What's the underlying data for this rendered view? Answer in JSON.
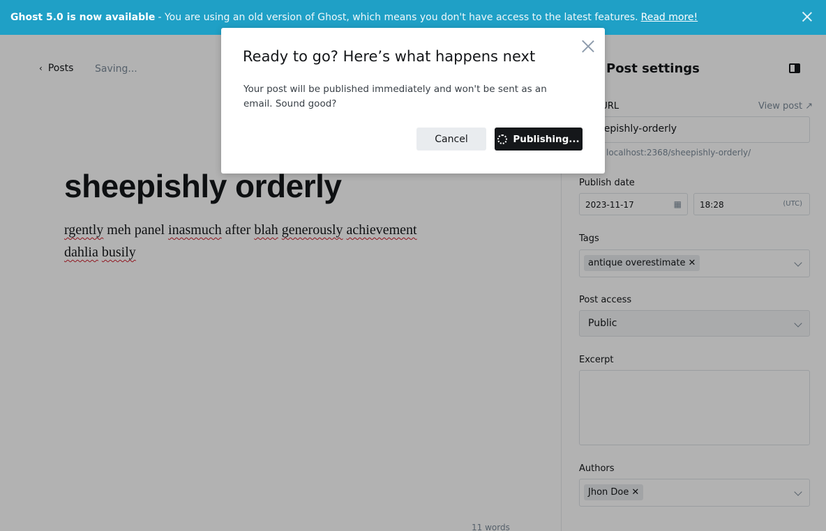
{
  "banner": {
    "headline": "Ghost 5.0 is now available",
    "message": "- You are using an old version of Ghost, which means you don't have access to the latest features.",
    "link": "Read more!"
  },
  "editor": {
    "back_label": "Posts",
    "status": "Saving...",
    "title": "sheepishly orderly",
    "body_words": [
      "rgently",
      "meh",
      "panel",
      "inasmuch",
      "after",
      "blah",
      "generously",
      "achievement",
      "dahlia",
      "busily"
    ],
    "word_count": "11 words"
  },
  "settings": {
    "title": "Post settings",
    "url_label": "Post URL",
    "view_post": "View post",
    "url_value": "sheepishly-orderly",
    "url_hint": "localhost:2368/sheepishly-orderly/",
    "publish_date_label": "Publish date",
    "date_value": "2023-11-17",
    "time_value": "18:28",
    "timezone": "(UTC)",
    "tags_label": "Tags",
    "tags": [
      "antique overestimate"
    ],
    "access_label": "Post access",
    "access_value": "Public",
    "excerpt_label": "Excerpt",
    "authors_label": "Authors",
    "authors": [
      "Jhon Doe"
    ]
  },
  "modal": {
    "title": "Ready to go? Here’s what happens next",
    "body": "Your post will be published immediately and won't be sent as an email. Sound good?",
    "cancel_label": "Cancel",
    "publish_label": "Publishing..."
  },
  "colors": {
    "banner_bg": "#1fa0c6",
    "primary_button": "#15171a",
    "overlay": "rgba(0,0,0,0.30)"
  }
}
